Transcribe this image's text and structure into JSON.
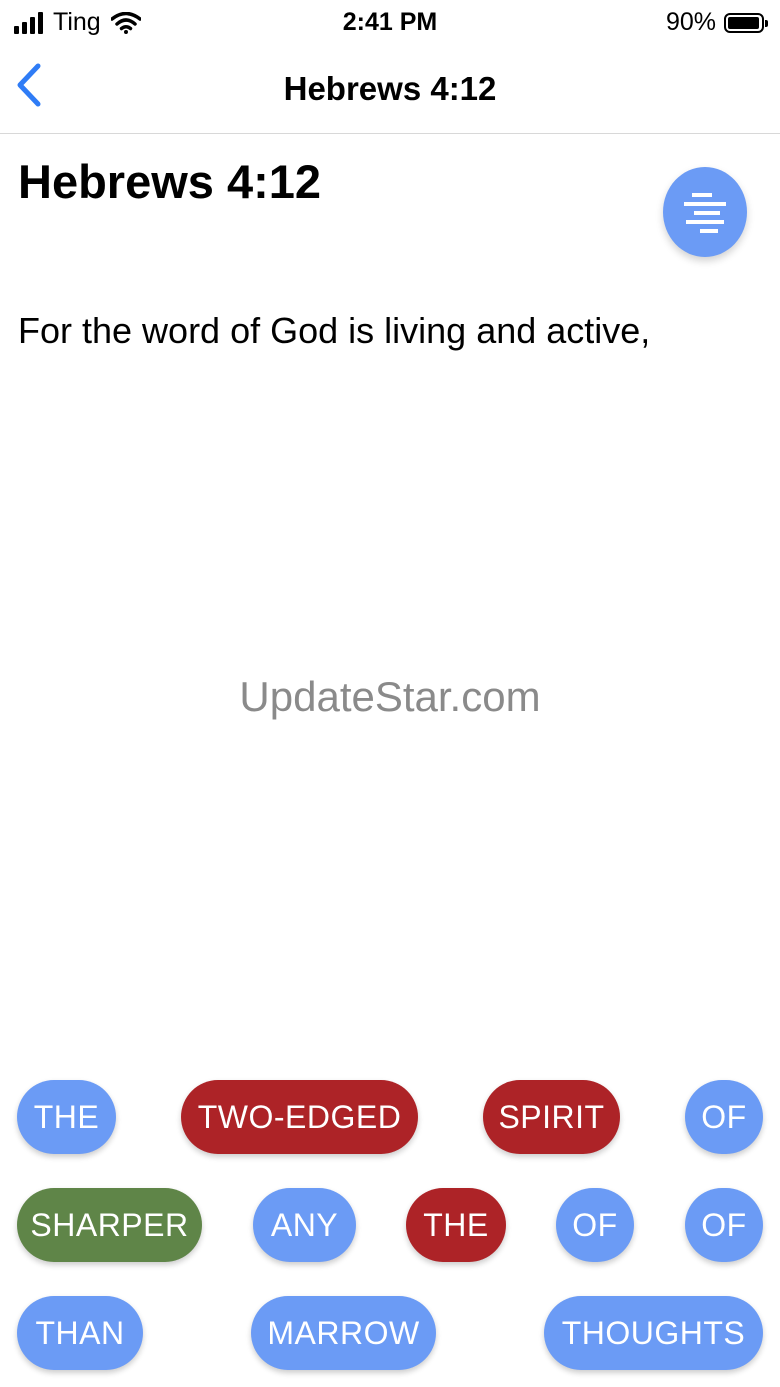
{
  "status_bar": {
    "carrier": "Ting",
    "time": "2:41 PM",
    "battery": "90%"
  },
  "nav": {
    "title": "Hebrews 4:12"
  },
  "verse": {
    "reference": "Hebrews 4:12",
    "text": "For the word of God is living and active,"
  },
  "watermark": "UpdateStar.com",
  "word_chips": [
    {
      "label": "THE",
      "color": "#6b9bf5"
    },
    {
      "label": "TWO-EDGED",
      "color": "#ad2327"
    },
    {
      "label": "SPIRIT",
      "color": "#ad2327"
    },
    {
      "label": "OF",
      "color": "#6b9bf5"
    },
    {
      "label": "SHARPER",
      "color": "#5f8548"
    },
    {
      "label": "ANY",
      "color": "#6b9bf5"
    },
    {
      "label": "THE",
      "color": "#ad2327"
    },
    {
      "label": "OF",
      "color": "#6b9bf5"
    },
    {
      "label": "OF",
      "color": "#6b9bf5"
    },
    {
      "label": "THAN",
      "color": "#6b9bf5"
    },
    {
      "label": "MARROW",
      "color": "#6b9bf5"
    },
    {
      "label": "THOUGHTS",
      "color": "#6b9bf5"
    }
  ],
  "icons": {
    "back": "chevron-left-icon",
    "fab": "hint-lines-icon",
    "wifi": "wifi-icon",
    "signal": "cellular-signal-icon",
    "battery": "battery-icon"
  }
}
